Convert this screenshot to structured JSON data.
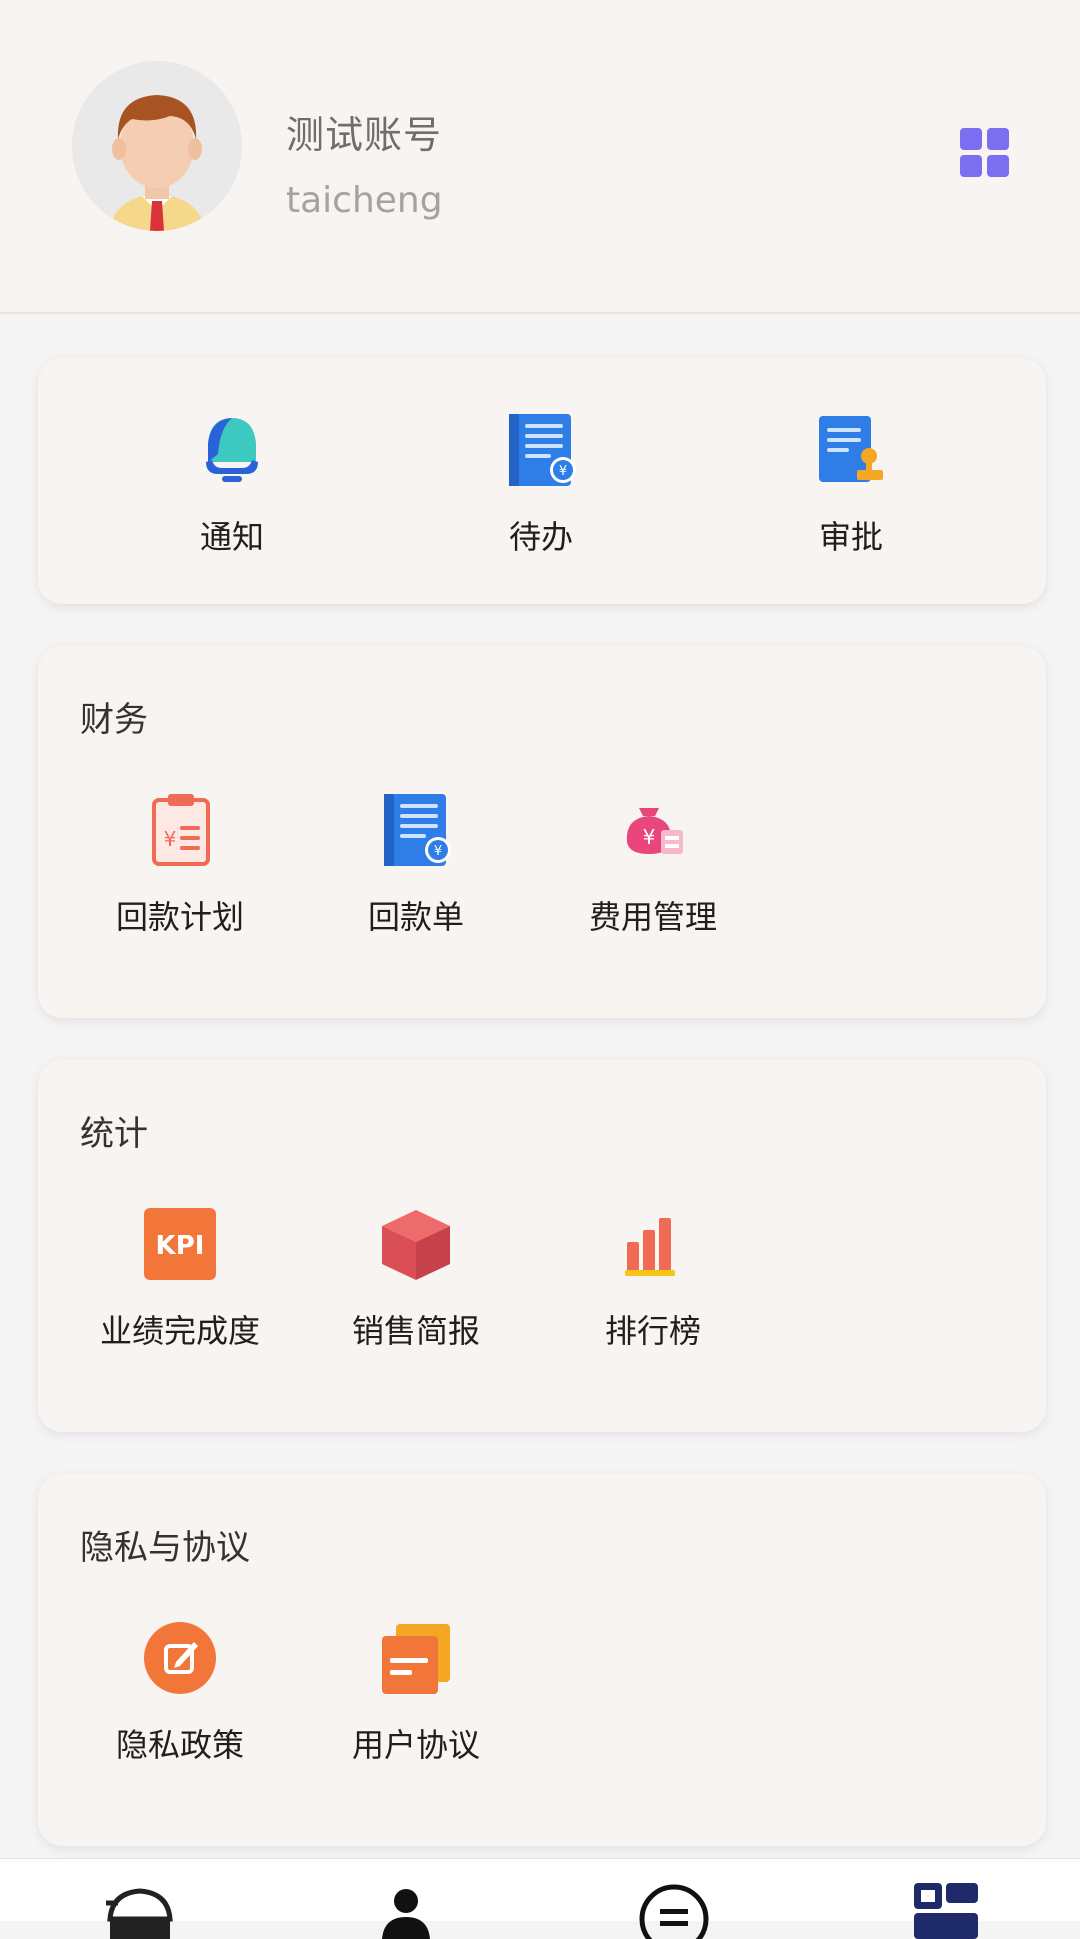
{
  "header": {
    "user_name": "测试账号",
    "account": "taicheng",
    "icons": {
      "avatar": "avatar-icon",
      "grid": "apps-grid-icon"
    },
    "grid_color": "#7b6ff0"
  },
  "quick": {
    "items": [
      {
        "label": "通知",
        "icon": "bell-icon"
      },
      {
        "label": "待办",
        "icon": "todo-doc-icon"
      },
      {
        "label": "审批",
        "icon": "approval-stamp-icon"
      }
    ]
  },
  "finance": {
    "title": "财务",
    "items": [
      {
        "label": "回款计划",
        "icon": "payment-plan-icon"
      },
      {
        "label": "回款单",
        "icon": "payment-receipt-icon"
      },
      {
        "label": "费用管理",
        "icon": "expense-bag-icon"
      }
    ]
  },
  "stats": {
    "title": "统计",
    "items": [
      {
        "label": "业绩完成度",
        "icon": "kpi-icon"
      },
      {
        "label": "销售简报",
        "icon": "sales-box-icon"
      },
      {
        "label": "排行榜",
        "icon": "ranking-bars-icon"
      }
    ]
  },
  "privacy": {
    "title": "隐私与协议",
    "items": [
      {
        "label": "隐私政策",
        "icon": "privacy-edit-icon"
      },
      {
        "label": "用户协议",
        "icon": "user-agreement-icon"
      }
    ]
  },
  "tabbar": {
    "items": [
      {
        "icon": "home-icon"
      },
      {
        "icon": "contacts-icon"
      },
      {
        "icon": "messages-icon"
      },
      {
        "icon": "workbench-icon",
        "active": true
      }
    ],
    "active_color": "#1f2a6b"
  }
}
